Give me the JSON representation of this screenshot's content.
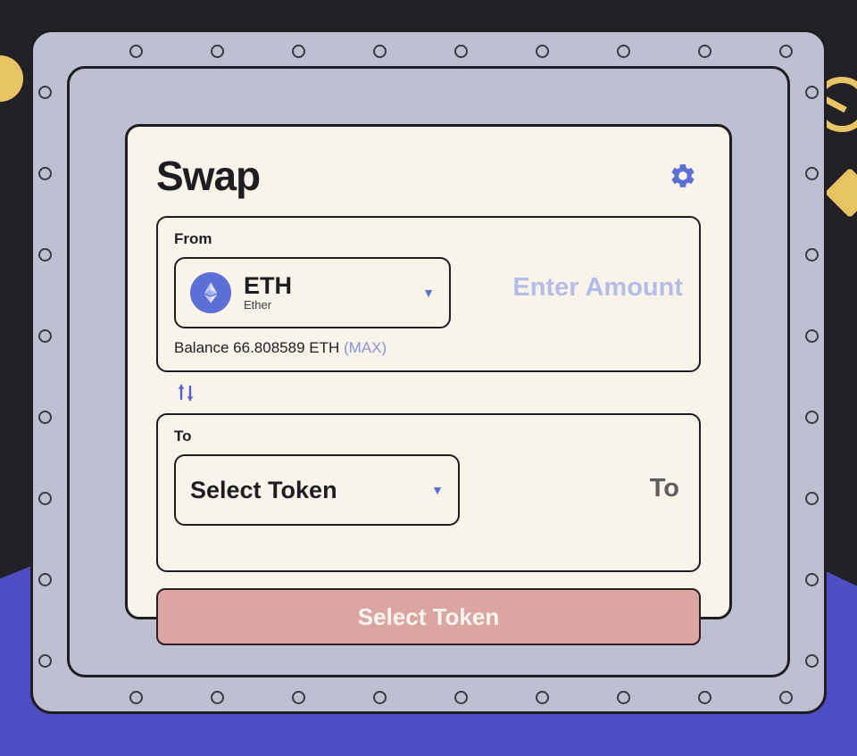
{
  "app": {
    "title": "Swap",
    "settings_icon": "gear-icon"
  },
  "from_panel": {
    "label": "From",
    "token": {
      "symbol": "ETH",
      "name": "Ether",
      "logo_icon": "ethereum-logo-icon",
      "logo_color": "#5c6fd6",
      "chevron_icon": "chevron-down-icon"
    },
    "amount_placeholder": "Enter Amount",
    "amount_value": "",
    "balance_prefix": "Balance",
    "balance_value": "66.808589",
    "balance_symbol": "ETH",
    "max_label": "(MAX)"
  },
  "swap_direction": {
    "icon": "swap-vertical-arrows-icon"
  },
  "to_panel": {
    "label": "To",
    "token": {
      "placeholder": "Select Token",
      "chevron_icon": "chevron-down-icon"
    },
    "amount_readout": "To"
  },
  "action": {
    "label": "Select Token"
  },
  "theme": {
    "accent": "#5c6fd6",
    "accent_light": "#b6bce8",
    "card_bg": "#f8f4ea",
    "frame": "#bfbfd2",
    "outline": "#1e1e22",
    "button_bg": "#dba5a2",
    "background": "#222226",
    "background_wedge": "#4f4dc4",
    "gold": "#e8c464"
  }
}
